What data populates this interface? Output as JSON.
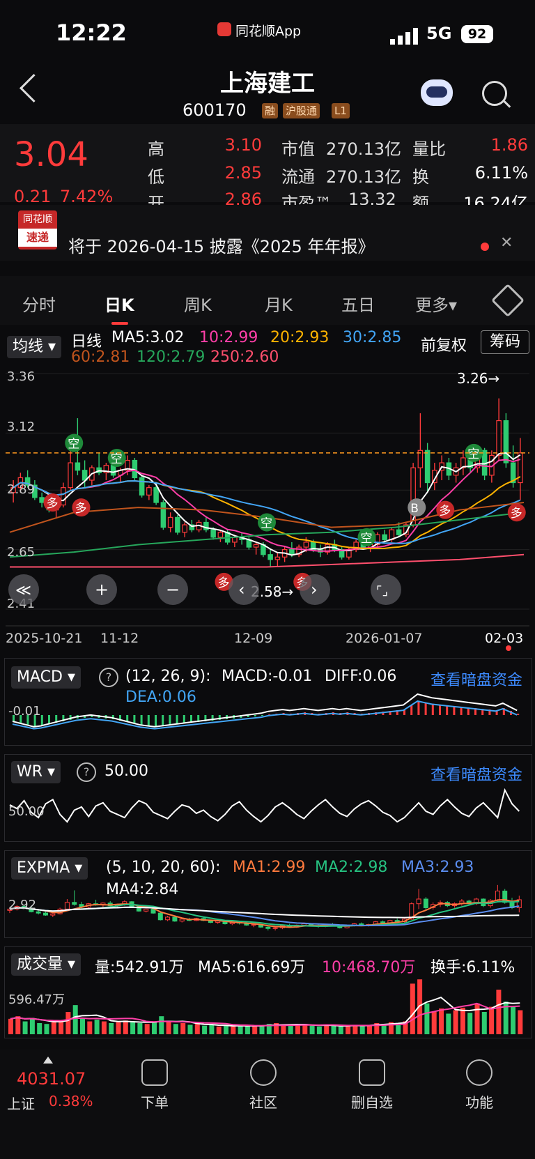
{
  "status_bar": {
    "time": "12:22",
    "app": "同花顺App",
    "network": "5G",
    "battery": "92"
  },
  "header": {
    "name": "上海建工",
    "code": "600170",
    "tags": [
      "融",
      "沪股通",
      "L1"
    ]
  },
  "quote": {
    "price": "3.04",
    "change": "0.21",
    "change_pct": "7.42%",
    "rows": [
      {
        "l1": "高",
        "v1": "3.10",
        "l2": "市值",
        "v2": "270.13亿",
        "l3": "量比",
        "v3": "1.86"
      },
      {
        "l1": "低",
        "v1": "2.85",
        "l2": "流通",
        "v2": "270.13亿",
        "l3": "换",
        "v3": "6.11%"
      },
      {
        "l1": "开",
        "v1": "2.86",
        "l2": "市盈™",
        "v2": "13.32",
        "l3": "额",
        "v3": "16.24亿"
      }
    ]
  },
  "news": {
    "badge_top": "同花顺",
    "badge_bottom": "速递",
    "text": "将于 2026-04-15 披露《2025 年年报》"
  },
  "tabs": [
    "分时",
    "日K",
    "周K",
    "月K",
    "五日",
    "更多▾"
  ],
  "ma_legend": {
    "selector": "均线 ▾",
    "label": "日线",
    "ma5": "MA5:3.02",
    "ma10": "10:2.99",
    "ma20": "20:2.93",
    "ma30": "30:2.85",
    "ma60": "60:2.81",
    "ma120": "120:2.79",
    "ma250": "250:2.60",
    "adjust": "前复权",
    "chips": "筹码"
  },
  "colors": {
    "up": "#ff3b3b",
    "down": "#2ecc71",
    "ma5": "#ffffff",
    "ma10": "#ff3fa8",
    "ma20": "#ffb300",
    "ma30": "#42a5f5",
    "ma60": "#c0541d",
    "ma120": "#26a65b",
    "ma250": "#ff4f6d"
  },
  "chart_data": [
    {
      "type": "candlestick",
      "title": "",
      "y_ticks": [
        "3.36",
        "3.12",
        "2.89",
        "2.65",
        "2.41"
      ],
      "x_ticks": [
        "2025-10-21",
        "11-12",
        "12-09",
        "2026-01-07",
        "02-03"
      ],
      "annotations": {
        "high_marker": "3.26→",
        "low_marker": "2.58→",
        "reference_line": 3.04
      },
      "signals": [
        "空",
        "多",
        "空",
        "多",
        "空",
        "多",
        "空",
        "多",
        "B",
        "空",
        "多",
        "多"
      ],
      "ohlc": [
        [
          2.88,
          2.93,
          2.84,
          2.9
        ],
        [
          2.9,
          2.96,
          2.88,
          2.94
        ],
        [
          2.94,
          2.97,
          2.9,
          2.91
        ],
        [
          2.91,
          2.93,
          2.85,
          2.86
        ],
        [
          2.86,
          2.88,
          2.82,
          2.84
        ],
        [
          2.84,
          2.86,
          2.8,
          2.81
        ],
        [
          2.81,
          2.84,
          2.78,
          2.83
        ],
        [
          2.83,
          2.92,
          2.82,
          2.9
        ],
        [
          2.9,
          3.05,
          2.89,
          3.0
        ],
        [
          3.0,
          3.18,
          2.95,
          2.97
        ],
        [
          2.97,
          3.01,
          2.9,
          2.93
        ],
        [
          2.93,
          2.99,
          2.91,
          2.98
        ],
        [
          2.98,
          3.04,
          2.95,
          2.96
        ],
        [
          2.96,
          3.0,
          2.93,
          2.99
        ],
        [
          2.99,
          3.02,
          2.94,
          2.95
        ],
        [
          2.95,
          2.98,
          2.92,
          2.97
        ],
        [
          2.97,
          3.03,
          2.95,
          3.01
        ],
        [
          3.01,
          3.02,
          2.93,
          2.94
        ],
        [
          2.94,
          2.95,
          2.86,
          2.87
        ],
        [
          2.87,
          2.91,
          2.85,
          2.9
        ],
        [
          2.9,
          2.92,
          2.83,
          2.84
        ],
        [
          2.84,
          2.85,
          2.73,
          2.74
        ],
        [
          2.74,
          2.8,
          2.72,
          2.78
        ],
        [
          2.78,
          2.79,
          2.71,
          2.72
        ],
        [
          2.72,
          2.76,
          2.7,
          2.75
        ],
        [
          2.75,
          2.77,
          2.72,
          2.73
        ],
        [
          2.73,
          2.77,
          2.72,
          2.76
        ],
        [
          2.76,
          2.78,
          2.72,
          2.73
        ],
        [
          2.73,
          2.74,
          2.69,
          2.7
        ],
        [
          2.7,
          2.73,
          2.68,
          2.72
        ],
        [
          2.72,
          2.73,
          2.67,
          2.68
        ],
        [
          2.68,
          2.71,
          2.66,
          2.7
        ],
        [
          2.7,
          2.72,
          2.67,
          2.69
        ],
        [
          2.69,
          2.7,
          2.65,
          2.66
        ],
        [
          2.66,
          2.68,
          2.63,
          2.67
        ],
        [
          2.67,
          2.68,
          2.62,
          2.63
        ],
        [
          2.63,
          2.65,
          2.58,
          2.61
        ],
        [
          2.61,
          2.64,
          2.58,
          2.62
        ],
        [
          2.62,
          2.66,
          2.6,
          2.65
        ],
        [
          2.65,
          2.68,
          2.62,
          2.63
        ],
        [
          2.63,
          2.67,
          2.62,
          2.66
        ],
        [
          2.66,
          2.7,
          2.64,
          2.68
        ],
        [
          2.68,
          2.69,
          2.64,
          2.65
        ],
        [
          2.65,
          2.67,
          2.62,
          2.64
        ],
        [
          2.64,
          2.68,
          2.63,
          2.67
        ],
        [
          2.67,
          2.69,
          2.64,
          2.65
        ],
        [
          2.65,
          2.66,
          2.61,
          2.62
        ],
        [
          2.62,
          2.66,
          2.61,
          2.65
        ],
        [
          2.65,
          2.69,
          2.64,
          2.68
        ],
        [
          2.68,
          2.7,
          2.65,
          2.66
        ],
        [
          2.66,
          2.68,
          2.64,
          2.67
        ],
        [
          2.67,
          2.72,
          2.66,
          2.71
        ],
        [
          2.71,
          2.73,
          2.68,
          2.69
        ],
        [
          2.69,
          2.74,
          2.68,
          2.73
        ],
        [
          2.73,
          2.76,
          2.7,
          2.71
        ],
        [
          2.71,
          2.76,
          2.7,
          2.75
        ],
        [
          2.75,
          3.0,
          2.74,
          2.98
        ],
        [
          2.98,
          3.2,
          2.9,
          3.05
        ],
        [
          3.05,
          3.08,
          2.88,
          2.92
        ],
        [
          2.92,
          3.0,
          2.89,
          2.97
        ],
        [
          2.97,
          3.03,
          2.93,
          3.0
        ],
        [
          3.0,
          3.02,
          2.93,
          2.95
        ],
        [
          2.95,
          3.0,
          2.92,
          2.98
        ],
        [
          2.98,
          3.05,
          2.95,
          3.02
        ],
        [
          3.02,
          3.04,
          2.96,
          2.98
        ],
        [
          2.98,
          3.07,
          2.96,
          3.05
        ],
        [
          3.05,
          3.06,
          2.93,
          2.95
        ],
        [
          2.95,
          3.05,
          2.92,
          3.03
        ],
        [
          3.03,
          3.26,
          3.01,
          3.17
        ],
        [
          3.17,
          3.2,
          2.98,
          3.0
        ],
        [
          3.0,
          3.07,
          2.9,
          2.92
        ],
        [
          2.92,
          3.1,
          2.85,
          3.04
        ]
      ]
    },
    {
      "type": "bar",
      "title": "MACD",
      "params": "(12, 26, 9):",
      "macd": "MACD:-0.01",
      "diff": "DIFF:0.06",
      "dea": "DEA:0.06",
      "y_tick": "-0.01",
      "link": "查看暗盘资金"
    },
    {
      "type": "line",
      "title": "WR",
      "value": "50.00",
      "y_tick": "50.00",
      "link": "查看暗盘资金",
      "values": [
        62,
        55,
        70,
        48,
        38,
        64,
        72,
        44,
        30,
        52,
        58,
        40,
        60,
        66,
        50,
        44,
        38,
        56,
        70,
        64,
        48,
        42,
        36,
        50,
        62,
        58,
        46,
        52,
        40,
        32,
        44,
        60,
        68,
        52,
        40,
        30,
        42,
        58,
        66,
        56,
        44,
        36,
        50,
        62,
        72,
        58,
        46,
        40,
        54,
        64,
        70,
        60,
        48,
        42,
        30,
        38,
        52,
        66,
        50,
        44,
        60,
        72,
        58,
        46,
        40,
        56,
        66,
        52,
        38,
        90,
        64,
        50
      ]
    },
    {
      "type": "line",
      "title": "EXPMA",
      "params": "(5, 10, 20, 60):",
      "ma1": "MA1:2.99",
      "ma2": "MA2:2.98",
      "ma3": "MA3:2.93",
      "ma4": "MA4:2.84",
      "y_tick": "2.92"
    },
    {
      "type": "bar",
      "title": "成交量",
      "volume": "量:542.91万",
      "ma5": "MA5:616.69万",
      "ma10": "10:468.70万",
      "turnover": "换手:6.11%",
      "y_tick": "596.47万",
      "values": [
        360,
        420,
        300,
        380,
        260,
        240,
        280,
        300,
        520,
        680,
        380,
        300,
        340,
        300,
        260,
        280,
        320,
        300,
        260,
        240,
        280,
        420,
        300,
        240,
        260,
        220,
        240,
        200,
        220,
        180,
        200,
        180,
        220,
        200,
        180,
        200,
        240,
        260,
        220,
        200,
        220,
        240,
        200,
        180,
        220,
        200,
        180,
        200,
        220,
        200,
        220,
        260,
        240,
        280,
        260,
        300,
        1180,
        1280,
        720,
        520,
        600,
        480,
        560,
        620,
        500,
        720,
        520,
        640,
        1040,
        760,
        640,
        560
      ]
    }
  ],
  "chart_controls": [
    "≪",
    "+",
    "−",
    "‹",
    "›",
    "⌜⌟"
  ],
  "bottom_nav": {
    "index_value": "4031.07",
    "index_name": "上证",
    "index_pct": "0.38%",
    "items": [
      "下单",
      "社区",
      "删自选",
      "功能"
    ]
  }
}
